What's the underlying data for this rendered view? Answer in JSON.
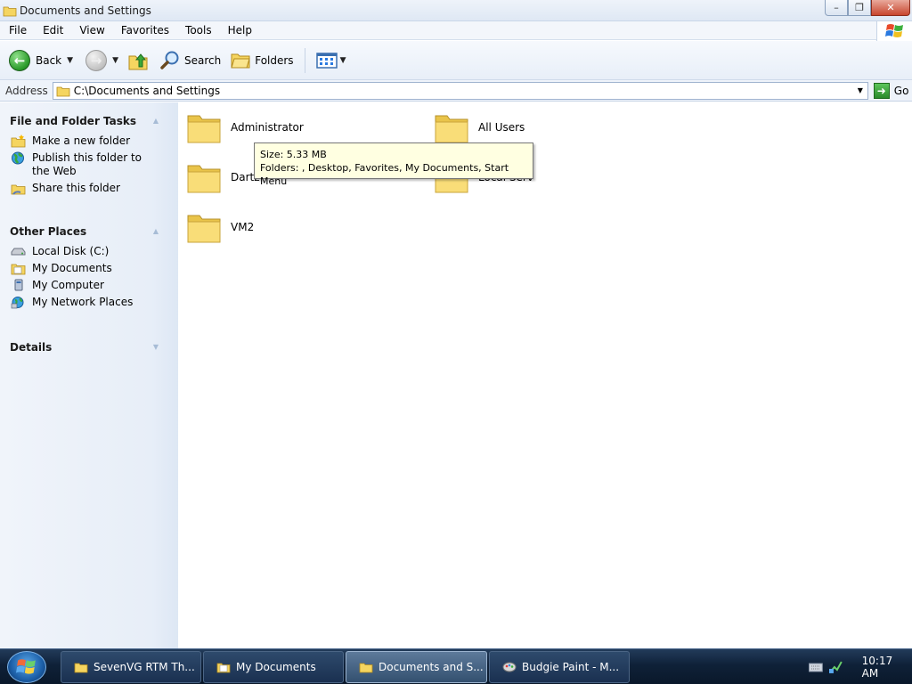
{
  "window": {
    "title": "Documents and Settings",
    "controls": {
      "minimize": "–",
      "maximize": "❐",
      "close": "✕"
    }
  },
  "menubar": {
    "items": [
      "File",
      "Edit",
      "View",
      "Favorites",
      "Tools",
      "Help"
    ]
  },
  "toolbar": {
    "back_label": "Back",
    "search_label": "Search",
    "folders_label": "Folders"
  },
  "address": {
    "label": "Address",
    "value": "C:\\Documents and Settings",
    "go_label": "Go"
  },
  "taskpane": {
    "file_tasks": {
      "title": "File and Folder Tasks",
      "items": [
        "Make a new folder",
        "Publish this folder to the Web",
        "Share this folder"
      ]
    },
    "other_places": {
      "title": "Other Places",
      "items": [
        "Local Disk (C:)",
        "My Documents",
        "My Computer",
        "My Network Places"
      ]
    },
    "details": {
      "title": "Details"
    }
  },
  "folders": [
    "Administrator",
    "All Users",
    "Dartz",
    "Local Serv",
    "VM2"
  ],
  "tooltip": {
    "size": "Size: 5.33 MB",
    "folders": "Folders: , Desktop, Favorites, My Documents, Start Menu"
  },
  "taskbar": {
    "buttons": [
      {
        "label": "SevenVG RTM Th...",
        "icon": "folder-icon"
      },
      {
        "label": "My Documents",
        "icon": "document-folder-icon"
      },
      {
        "label": "Documents and S...",
        "icon": "folder-icon"
      },
      {
        "label": "Budgie Paint - M...",
        "icon": "paint-icon"
      }
    ],
    "clock": "10:17 AM"
  },
  "colors": {
    "folder_yellow": "#f7d96a",
    "tooltip_bg": "#ffffe1",
    "taskbar_dark": "#0f2138"
  }
}
